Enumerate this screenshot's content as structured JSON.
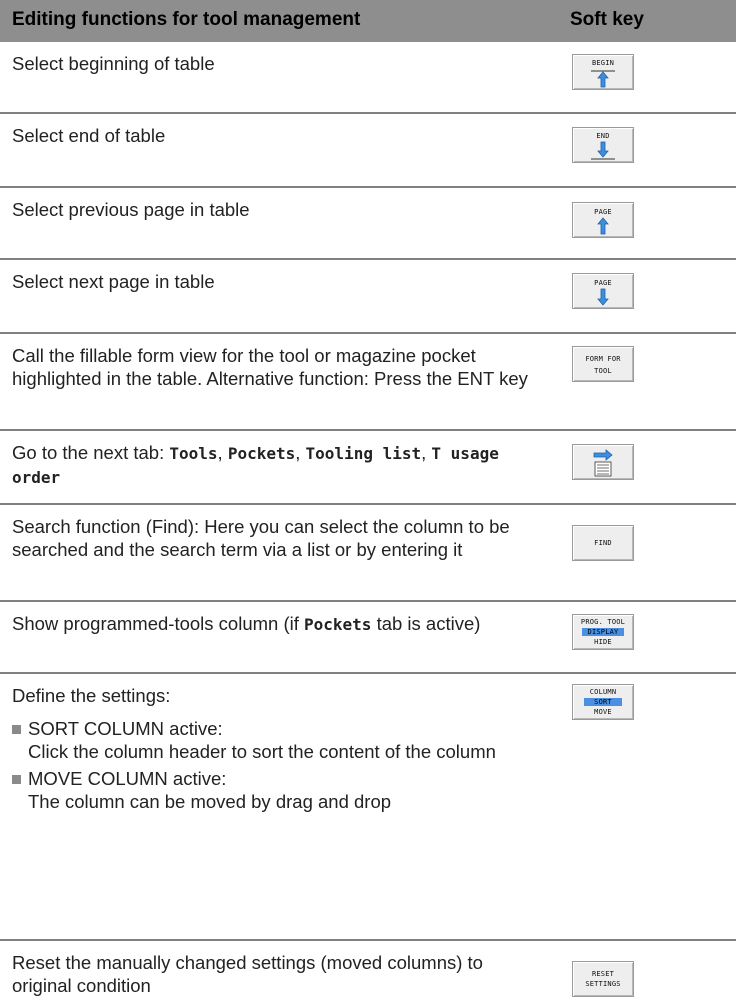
{
  "table": {
    "header": {
      "col_function": "Editing functions for tool management",
      "col_softkey": "Soft key"
    },
    "rows": [
      {
        "text": "Select beginning of table",
        "softkey": {
          "label": "BEGIN",
          "icon": "arrow-up-with-bar-icon"
        }
      },
      {
        "text": "Select end of table",
        "softkey": {
          "label": "END",
          "icon": "arrow-down-with-bar-icon"
        }
      },
      {
        "text": "Select previous page in table",
        "softkey": {
          "label": "PAGE",
          "icon": "arrow-up-icon"
        }
      },
      {
        "text": "Select next page in table",
        "softkey": {
          "label": "PAGE",
          "icon": "arrow-down-icon"
        }
      },
      {
        "text": "Call the fillable form view for the tool or magazine pocket highlighted in the table. Alternative function: Press the ENT key",
        "softkey": {
          "line1": "FORM FOR",
          "line2": "TOOL"
        }
      },
      {
        "text_parts": [
          "Go to the next tab: ",
          "Tools",
          ", ",
          "Pockets",
          ", ",
          "Tooling list",
          ", ",
          "T usage order"
        ],
        "softkey": {
          "icon": "next-tab-arrow-icon"
        }
      },
      {
        "text": "Search function (Find): Here you can select the column to be searched and the search term via a list or by entering it",
        "softkey": {
          "label": "FIND"
        }
      },
      {
        "text_parts": [
          "Show programmed-tools column (if ",
          "Pockets",
          " tab is active)"
        ],
        "softkey": {
          "line1": "PROG. TOOL",
          "line2": "DISPLAY",
          "line3": "HIDE"
        }
      },
      {
        "text": "Define the settings:",
        "bullets": [
          {
            "title": "SORT COLUMN active:",
            "body": "Click the column header to sort the content of the column"
          },
          {
            "title": "MOVE COLUMN active:",
            "body": "The column can be moved by drag and drop"
          }
        ],
        "softkey": {
          "line1": "COLUMN",
          "line2": "SORT",
          "line3": "MOVE"
        }
      },
      {
        "text": "Reset the manually changed settings (moved columns) to original condition",
        "softkey": {
          "line1": "RESET",
          "line2": "SETTINGS"
        }
      }
    ]
  },
  "colors": {
    "header_bg": "#8e8e8e",
    "separator": "#808080",
    "softkey_bg": "#eeeeee",
    "arrow": "#3b8fe0",
    "highlight": "#4a8fe0"
  }
}
